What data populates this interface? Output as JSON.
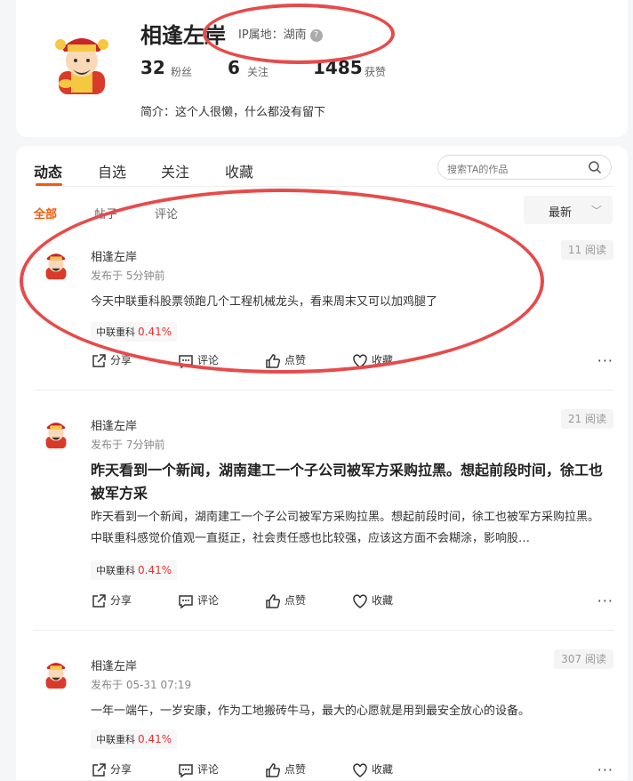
{
  "profile": {
    "name": "相逢左岸",
    "ip_label": "IP属地：湖南",
    "stats": [
      {
        "value": "32",
        "label": "粉丝"
      },
      {
        "value": "6",
        "label": "关注"
      },
      {
        "value": "1485",
        "label": "获赞"
      }
    ],
    "bio": "简介：这个人很懒，什么都没有留下"
  },
  "tabs": [
    "动态",
    "自选",
    "关注",
    "收藏"
  ],
  "search": {
    "placeholder": "搜索TA的作品"
  },
  "subtabs": [
    "全部",
    "帖子",
    "评论"
  ],
  "sort": {
    "label": "最新"
  },
  "actions": {
    "share": "分享",
    "comment": "评论",
    "like": "点赞",
    "collect": "收藏",
    "more": "···"
  },
  "posts": [
    {
      "author": "相逢左岸",
      "time": "发布于 5分钟前",
      "reads": "11 阅读",
      "title": "",
      "body": "今天中联重科股票领跑几个工程机械龙头，看来周末又可以加鸡腿了",
      "tag_name": "中联重科",
      "tag_pct": "0.41%"
    },
    {
      "author": "相逢左岸",
      "time": "发布于 7分钟前",
      "reads": "21 阅读",
      "title": "昨天看到一个新闻，湖南建工一个子公司被军方采购拉黑。想起前段时间，徐工也被军方采",
      "body": "昨天看到一个新闻，湖南建工一个子公司被军方采购拉黑。想起前段时间，徐工也被军方采购拉黑。 中联重科感觉价值观一直挺正，社会责任感也比较强，应该这方面不会糊涂，影响股…",
      "tag_name": "中联重科",
      "tag_pct": "0.41%"
    },
    {
      "author": "相逢左岸",
      "time": "发布于 05-31 07:19",
      "reads": "307 阅读",
      "title": "",
      "body": "一年一端午，一岁安康，作为工地搬砖牛马，最大的心愿就是用到最安全放心的设备。",
      "tag_name": "中联重科",
      "tag_pct": "0.41%"
    }
  ],
  "colors": {
    "accent": "#f45a0a",
    "up": "#e93030",
    "annotation": "#e64b4b"
  }
}
